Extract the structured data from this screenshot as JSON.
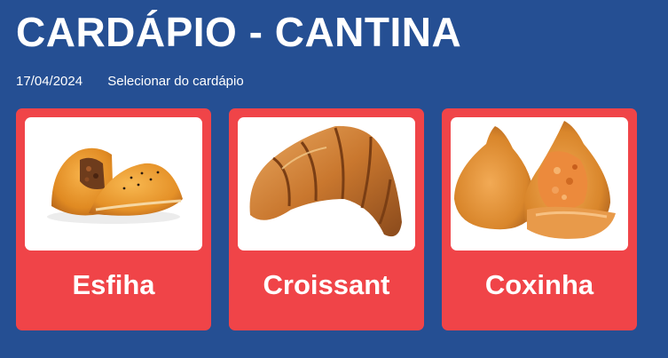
{
  "header": {
    "title": "CARDÁPIO - CANTINA"
  },
  "subbar": {
    "date": "17/04/2024",
    "select_label": "Selecionar do cardápio"
  },
  "menu": {
    "items": [
      {
        "name": "Esfiha",
        "image": "esfiha-image"
      },
      {
        "name": "Croissant",
        "image": "croissant-image"
      },
      {
        "name": "Coxinha",
        "image": "coxinha-image"
      }
    ]
  },
  "colors": {
    "background": "#254f93",
    "card": "#f04448",
    "text": "#ffffff"
  }
}
